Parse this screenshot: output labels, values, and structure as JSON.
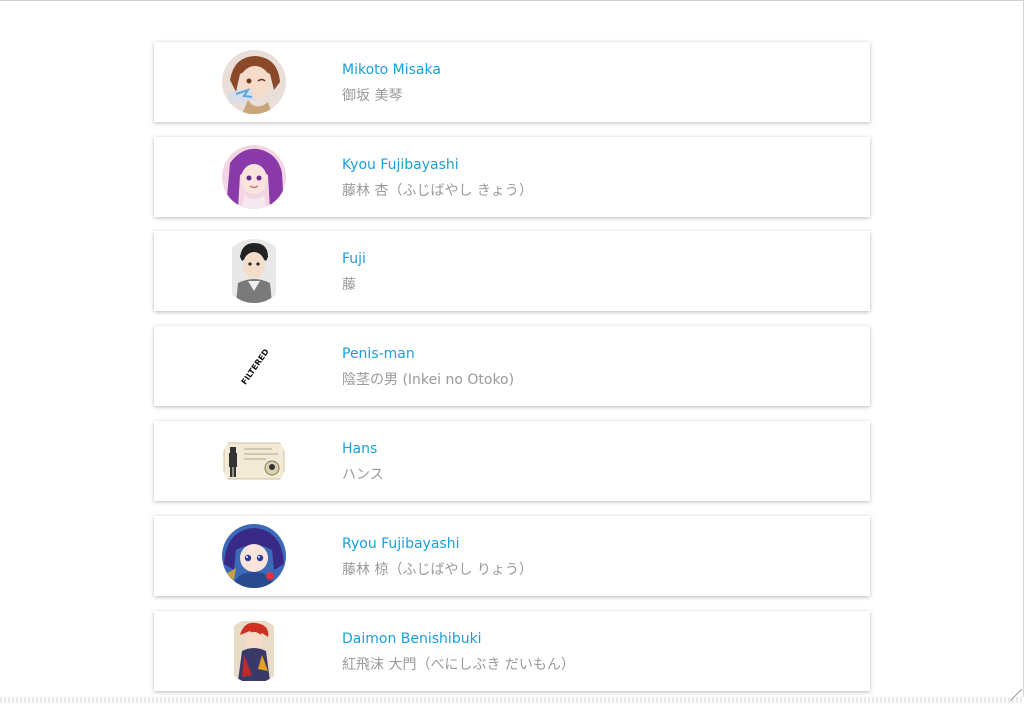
{
  "characters": [
    {
      "name": "Mikoto Misaka",
      "japanese": "御坂 美琴",
      "avatar_icon": "mikoto-misaka-avatar"
    },
    {
      "name": "Kyou Fujibayashi",
      "japanese": "藤林 杏（ふじばやし きょう）",
      "avatar_icon": "kyou-fujibayashi-avatar"
    },
    {
      "name": "Fuji",
      "japanese": "藤",
      "avatar_icon": "fuji-avatar"
    },
    {
      "name": "Penis-man",
      "japanese": "陰茎の男 (Inkei no Otoko)",
      "avatar_icon": "filtered-avatar",
      "avatar_text": "FILTERED"
    },
    {
      "name": "Hans",
      "japanese": "ハンス",
      "avatar_icon": "hans-avatar"
    },
    {
      "name": "Ryou Fujibayashi",
      "japanese": "藤林 椋（ふじばやし りょう）",
      "avatar_icon": "ryou-fujibayashi-avatar"
    },
    {
      "name": "Daimon Benishibuki",
      "japanese": "紅飛沫 大門（べにしぶき だいもん）",
      "avatar_icon": "daimon-benishibuki-avatar"
    }
  ],
  "colors": {
    "link": "#1aa0d8",
    "subtext": "#9a9a9a"
  }
}
